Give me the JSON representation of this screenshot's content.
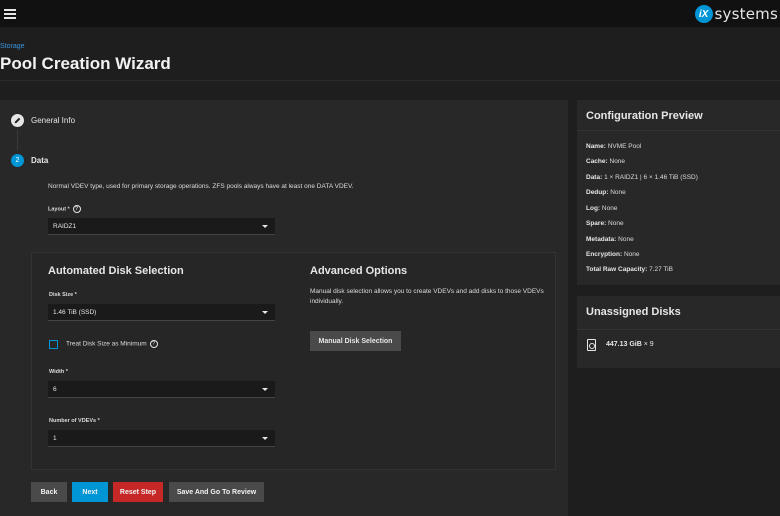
{
  "header": {
    "logo_badge": "iX",
    "logo_text": "systems"
  },
  "page": {
    "breadcrumb": "Storage",
    "title": "Pool Creation Wizard"
  },
  "steps": [
    {
      "number": "",
      "label": "General Info",
      "state": "done"
    },
    {
      "number": "2",
      "label": "Data",
      "state": "active"
    }
  ],
  "data_step": {
    "description": "Normal VDEV type, used for primary storage operations. ZFS pools always have at least one DATA VDEV.",
    "layout": {
      "label": "Layout *",
      "value": "RAIDZ1"
    },
    "automated": {
      "title": "Automated Disk Selection",
      "disk_size": {
        "label": "Disk Size *",
        "value": "1.46 TiB (SSD)"
      },
      "treat_min": {
        "label": "Treat Disk Size as Minimum",
        "checked": false
      },
      "width": {
        "label": "Width *",
        "value": "6"
      },
      "vdevs": {
        "label": "Number of VDEVs *",
        "value": "1"
      }
    },
    "advanced": {
      "title": "Advanced Options",
      "description": "Manual disk selection allows you to create VDEVs and add disks to those VDEVs individually.",
      "button": "Manual Disk Selection"
    }
  },
  "buttons": {
    "back": "Back",
    "next": "Next",
    "reset": "Reset Step",
    "save_review": "Save And Go To Review"
  },
  "preview": {
    "title": "Configuration Preview",
    "rows": [
      {
        "key": "Name:",
        "value": "NVME Pool"
      },
      {
        "key": "Cache:",
        "value": "None"
      },
      {
        "key": "Data:",
        "value": "1 × RAIDZ1 | 6 × 1.46 TiB (SSD)"
      },
      {
        "key": "Dedup:",
        "value": "None"
      },
      {
        "key": "Log:",
        "value": "None"
      },
      {
        "key": "Spare:",
        "value": "None"
      },
      {
        "key": "Metadata:",
        "value": "None"
      },
      {
        "key": "Encryption:",
        "value": "None"
      },
      {
        "key": "Total Raw Capacity:",
        "value": "7.27 TiB"
      }
    ]
  },
  "unassigned": {
    "title": "Unassigned Disks",
    "disk_size": "447.13 GiB",
    "disk_count": "× 9"
  },
  "colors": {
    "accent": "#0095d5",
    "danger": "#c62828",
    "surface": "#282828",
    "background": "#1e1e1e"
  }
}
